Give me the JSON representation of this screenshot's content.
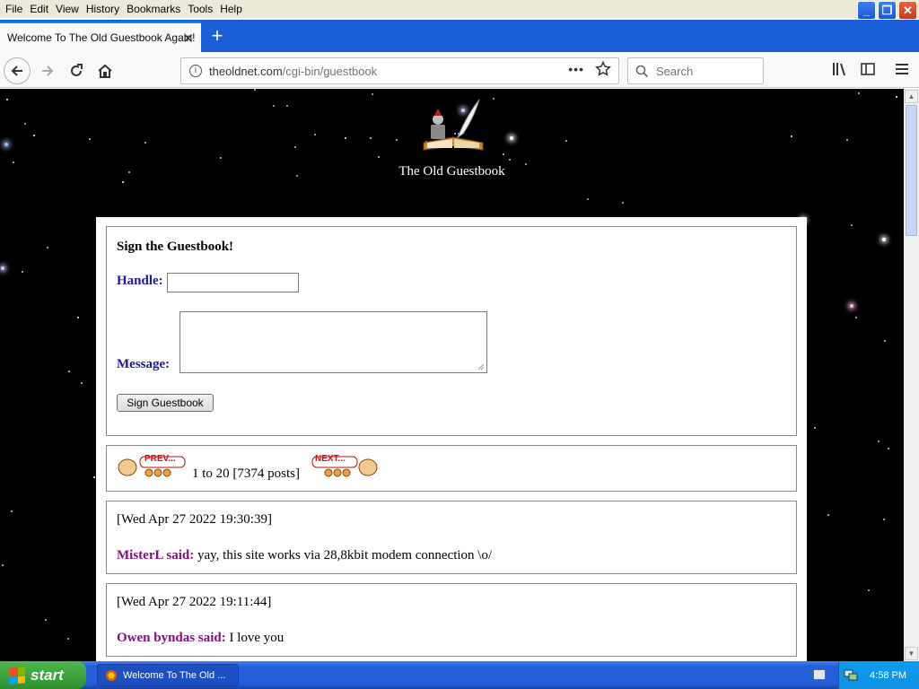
{
  "menu": [
    "File",
    "Edit",
    "View",
    "History",
    "Bookmarks",
    "Tools",
    "Help"
  ],
  "window_controls": {
    "minimize": "_",
    "maximize": "❐",
    "close": "✕"
  },
  "tab": {
    "title": "Welcome To The Old Guestbook Again!",
    "close": "✕",
    "new_tab": "+"
  },
  "nav": {
    "url_prefix": "theoldnet.com",
    "url_path": "/cgi-bin/guestbook",
    "search_placeholder": "Search",
    "info_icon": "i",
    "page_actions": "•••"
  },
  "site": {
    "title": "The Old Guestbook"
  },
  "form": {
    "heading": "Sign the Guestbook!",
    "handle_label": "Handle:",
    "handle_value": "",
    "message_label": "Message:",
    "message_value": "",
    "submit_label": "Sign Guestbook"
  },
  "pager": {
    "prev_label": "PREV...",
    "next_label": "NEXT...",
    "range_text": "1 to 20 [7374 posts]"
  },
  "posts": [
    {
      "date": "[Wed Apr 27 2022 19:30:39]",
      "author": "MisterL said:",
      "message": " yay, this site works via 28,8kbit modem connection \\o/"
    },
    {
      "date": "[Wed Apr 27 2022 19:11:44]",
      "author": "Owen byndas said:",
      "message": " I love you"
    }
  ],
  "taskbar": {
    "start_label": "start",
    "task_label": "Welcome To The Old ...",
    "clock": "4:58 PM"
  },
  "colors": {
    "label_blue": "#1a1a9c",
    "author_purple": "#800f80",
    "page_bg": "#000000"
  }
}
